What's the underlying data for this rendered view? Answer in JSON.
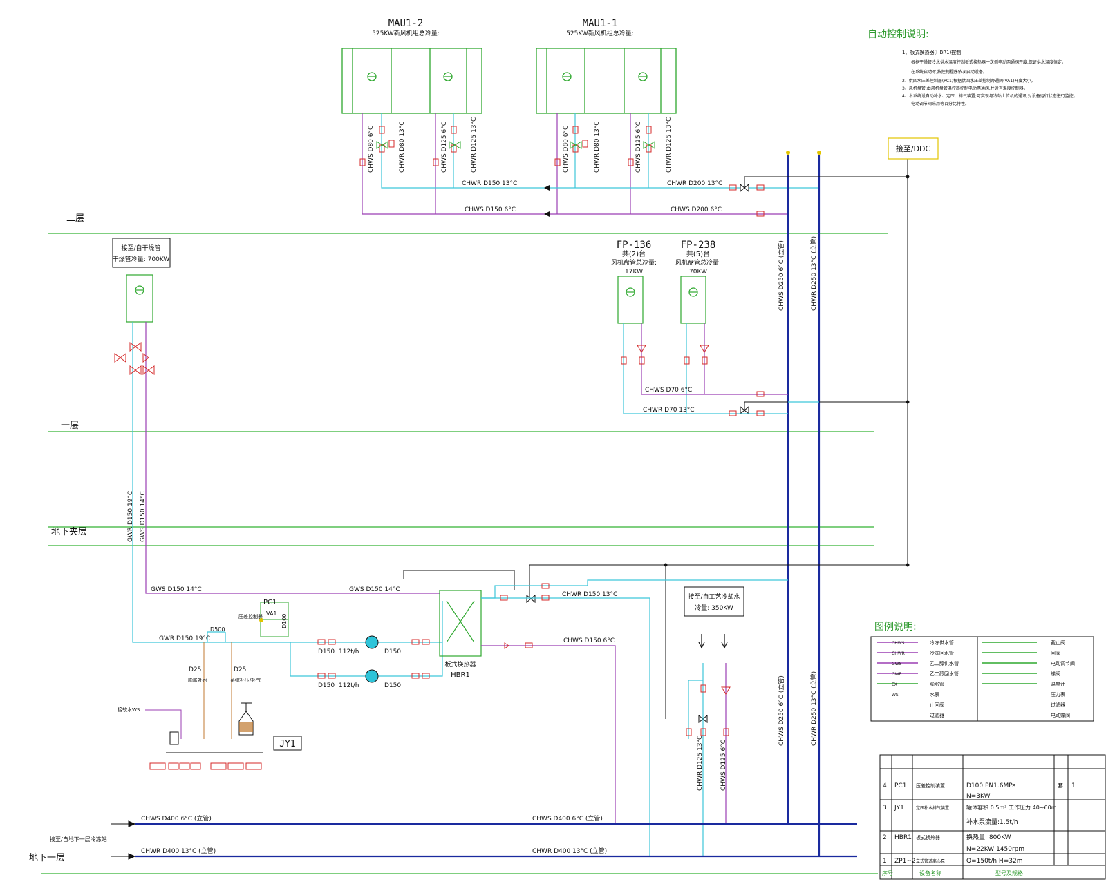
{
  "floors": {
    "second": "二层",
    "first": "一层",
    "mezzanine": "地下夹层",
    "basement": "地下一层"
  },
  "mau": [
    {
      "name": "MAU1-2",
      "cap": "525KW新风机组总冷量:"
    },
    {
      "name": "MAU1-1",
      "cap": "525KW新风机组总冷量:"
    }
  ],
  "fp": [
    {
      "name": "FP-136",
      "count": "共(2)台",
      "desc": "风机盘管总冷量:",
      "kw": "17KW"
    },
    {
      "name": "FP-238",
      "count": "共(5)台",
      "desc": "风机盘管总冷量:",
      "kw": "70KW"
    }
  ],
  "dryer": {
    "line1": "接至/自干燥管",
    "line2": "干燥管冷量: 700KW"
  },
  "process": {
    "line1": "接至/自工艺冷却水",
    "line2": "冷量: 350KW"
  },
  "ddc_label": "接至/DDC",
  "pipes": {
    "mau2_chws_branch": "CHWS D80 6°C",
    "mau2_chwr_branch": "CHWR D80 13°C",
    "mau2_chws_branch2": "CHWS D125 6°C",
    "mau2_chwr_branch2": "CHWR D125 13°C",
    "mau1_chws_branch": "CHWS D80 6°C",
    "mau1_chwr_branch": "CHWR D80 13°C",
    "mau1_chws_branch2": "CHWS D125 6°C",
    "mau1_chwr_branch2": "CHWR D125 13°C",
    "chwr_d150": "CHWR D150 13°C",
    "chwr_d200": "CHWR D200 13°C",
    "chws_d150": "CHWS D150 6°C",
    "chws_d200": "CHWS D200 6°C",
    "riser_chws": "CHWS D250 6°C (立管)",
    "riser_chwr": "CHWR D250 13°C (立管)",
    "chws_d70": "CHWS D70 6°C",
    "chwr_d70": "CHWR D70 13°C",
    "gwr_vert": "GWR D150 19°C",
    "gws_vert": "GWS D150 14°C",
    "gws_h1": "GWS D150 14°C",
    "gws_h2": "GWS D150 14°C",
    "gwr_h": "GWR D150 19°C",
    "chwr_hbr": "CHWR D150 13°C",
    "chws_hbr": "CHWS D150 6°C",
    "proc_chwr": "CHWR D125 13°C",
    "proc_chws": "CHWS D125 6°C",
    "chws_d400_a": "CHWS D400 6°C (立管)",
    "chws_d400_b": "CHWS D400 6°C (立管)",
    "chwr_d400_a": "CHWR D400 13°C (立管)",
    "chwr_d400_b": "CHWR D400 13°C (立管)",
    "basement_note": "接至/自地下一层冷冻站",
    "d150_a": "D150",
    "d150_b": "D150",
    "d150_c": "D150",
    "d150_d": "D150",
    "flow_a": "112t/h",
    "flow_b": "112t/h",
    "d500": "D500",
    "d100": "D100",
    "d25_a": "D25",
    "d25_b": "D25",
    "d25_a_note": "膨胀补水",
    "d25_b_note": "系统补压/补气"
  },
  "equip": {
    "pc1": "PC1",
    "va1": "VA1",
    "pc1_note": "压差控制器",
    "hbr": "HBR1",
    "hbr_note": "板式换热器",
    "jy1": "JY1",
    "softwater": "接软水WS"
  },
  "control": {
    "title": "自动控制说明:",
    "items": [
      "1、板式换热器(HBR1)控制:",
      "根据干燥管冷水供水温度控制板式换热器一次侧电动两通阀开度,保证供水温度恒定。",
      "在系统启动时,按控制程序依次启动设备。",
      "2、供回水压差控制器(PC1)根据供回水压差控制旁通阀(VA1)开度大小。",
      "3、风机盘管:由风机盘管温控器控制电动两通阀,并设有温度控制器。",
      "4、本系统设自动补水、定压、排气装置;可实现与冷站上位机的通讯,对设备运行状态进行监控。",
      "电动调节阀采用等百分比特性。"
    ]
  },
  "legend": {
    "title": "图例说明:",
    "rows": [
      {
        "code": "CHWS",
        "desc": "冷冻供水管",
        "desc2": "截止阀"
      },
      {
        "code": "CHWR",
        "desc": "冷冻回水管",
        "desc2": "闸阀"
      },
      {
        "code": "GWS",
        "desc": "乙二醇供水管",
        "desc2": "电动调节阀"
      },
      {
        "code": "GWR",
        "desc": "乙二醇回水管",
        "desc2": "蝶阀"
      },
      {
        "code": "EX",
        "desc": "膨胀管",
        "desc2": "温度计"
      },
      {
        "code": "WS",
        "desc": "水表",
        "desc2": "压力表"
      },
      {
        "code": "",
        "desc": "止回阀",
        "desc2": "过滤器"
      },
      {
        "code": "",
        "desc": "过滤器",
        "desc2": "电动蝶阀"
      }
    ]
  },
  "equipment_table": {
    "rows": [
      {
        "no": "4",
        "code": "PC1",
        "name": "压差控制装置",
        "spec": "D100 PN1.6MPa",
        "unit": "套",
        "qty": "1"
      },
      {
        "no": "",
        "code": "",
        "name": "",
        "spec": "N=3KW",
        "unit": "",
        "qty": ""
      },
      {
        "no": "3",
        "code": "JY1",
        "name": "定压补水排气装置",
        "spec": "罐体容积:0.5m³  工作压力:40~60m",
        "unit": "",
        "qty": ""
      },
      {
        "no": "",
        "code": "",
        "name": "",
        "spec": "补水泵流量:1.5t/h",
        "unit": "",
        "qty": ""
      },
      {
        "no": "2",
        "code": "HBR1",
        "name": "板式换热器",
        "spec": "换热量: 800KW",
        "unit": "",
        "qty": ""
      },
      {
        "no": "",
        "code": "",
        "name": "",
        "spec": "N=22KW  1450rpm",
        "unit": "",
        "qty": ""
      },
      {
        "no": "1",
        "code": "ZP1~2",
        "name": "立式管道离心泵",
        "spec": "Q=150t/h   H=32m",
        "unit": "",
        "qty": ""
      }
    ],
    "footer": {
      "no": "序号",
      "name": "设备名称",
      "spec": "型号及规格"
    }
  },
  "colors": {
    "floor_line": "#33b233",
    "chws": "#9b3fb3",
    "chwr": "#3ec6d9",
    "riser": "#1a2a9e",
    "equip": "#2ea82e",
    "valve": "#d42a2a",
    "black": "#111111"
  }
}
